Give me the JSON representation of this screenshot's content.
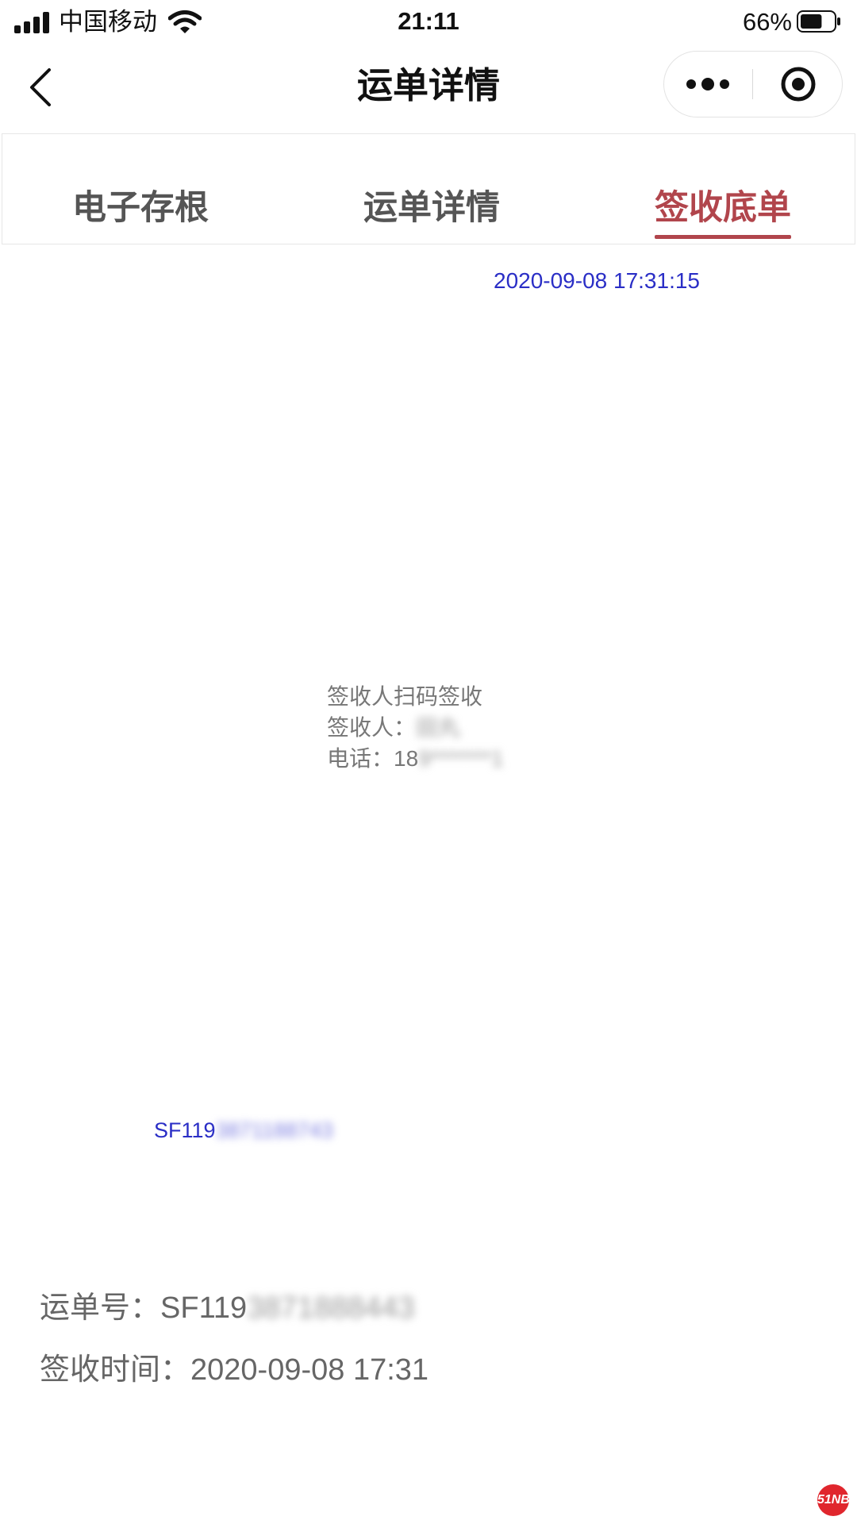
{
  "status_bar": {
    "carrier": "中国移动",
    "time": "21:11",
    "battery_percent": "66%",
    "battery_level": 0.66
  },
  "nav": {
    "title": "运单详情"
  },
  "tabs": [
    {
      "label": "电子存根",
      "active": false
    },
    {
      "label": "运单详情",
      "active": false
    },
    {
      "label": "签收底单",
      "active": true
    }
  ],
  "receipt": {
    "timestamp": "2020-09-08 17:31:15",
    "method": "签收人扫码签收",
    "signer_label": "签收人：",
    "signer_value": "田丸",
    "phone_label": "电话：",
    "phone_prefix": "18",
    "phone_masked": "9*******1",
    "waybill_prefix": "SF119",
    "waybill_masked": "3871188743"
  },
  "info": {
    "waybill_label": "运单号：",
    "waybill_prefix": "SF119",
    "waybill_masked": "3871888443",
    "sign_time_label": "签收时间：",
    "sign_time_value": "2020-09-08 17:31"
  },
  "badge": {
    "text": "51NB"
  },
  "colors": {
    "accent": "#b1454c",
    "link_blue": "#2a2ec6"
  }
}
